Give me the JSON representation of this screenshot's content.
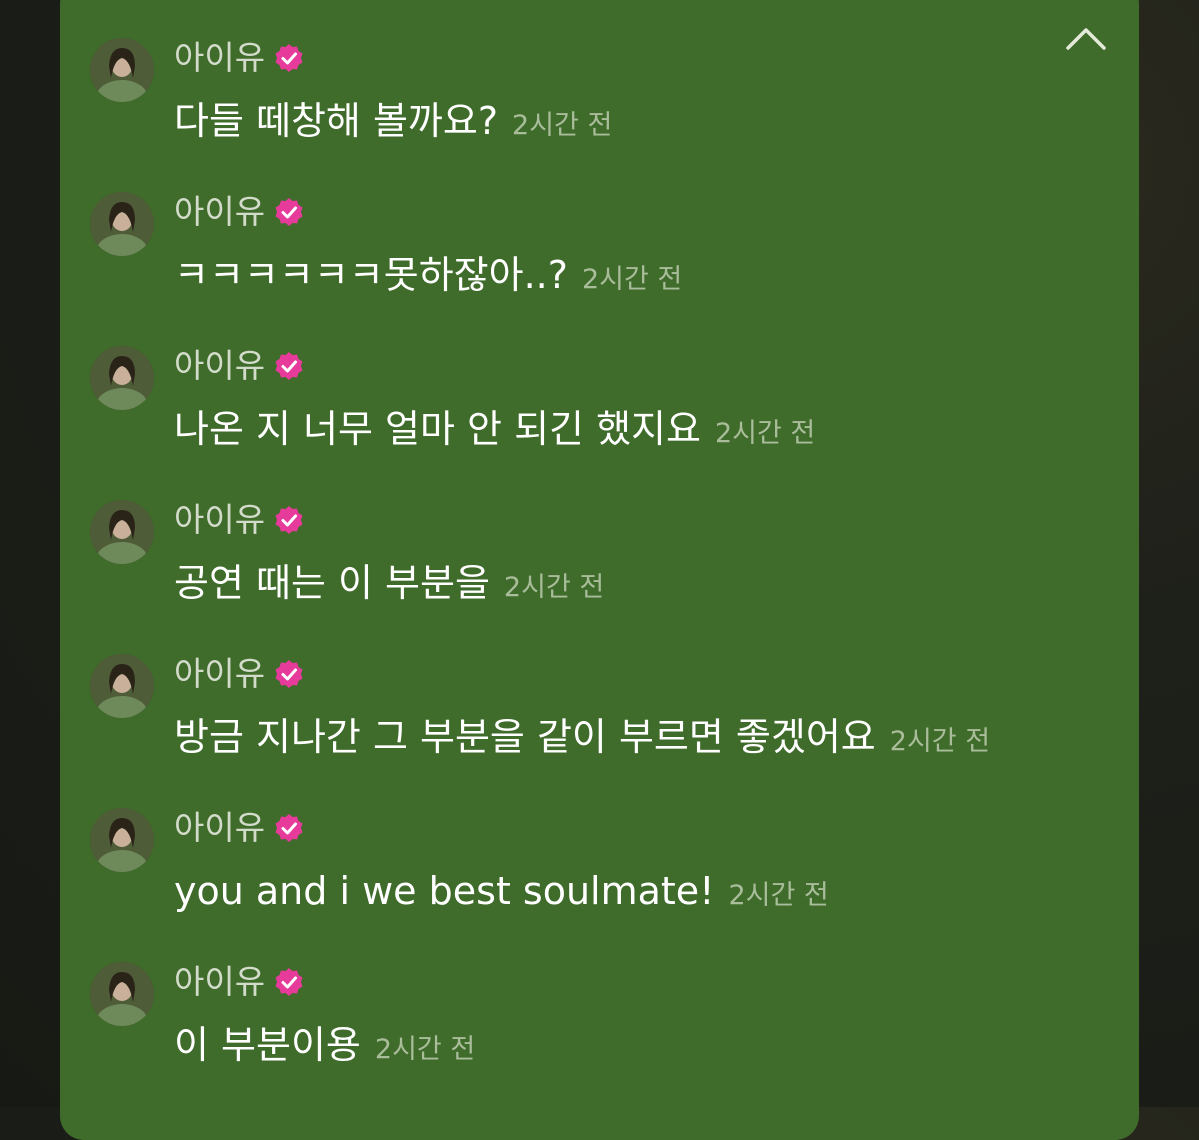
{
  "colors": {
    "panel_background": "#3f6b2b",
    "verified_badge": "#e63b9a",
    "timestamp": "#a9bd9a"
  },
  "header": {
    "collapse_icon": "chevron-up-icon"
  },
  "messages": [
    {
      "author": "아이유",
      "verified": true,
      "text": "다들 떼창해 볼까요?",
      "time": "2시간 전"
    },
    {
      "author": "아이유",
      "verified": true,
      "text": "ㅋㅋㅋㅋㅋㅋ못하잖아..?",
      "time": "2시간 전"
    },
    {
      "author": "아이유",
      "verified": true,
      "text": "나온 지 너무 얼마 안 되긴 했지요",
      "time": "2시간 전"
    },
    {
      "author": "아이유",
      "verified": true,
      "text": "공연 때는 이 부분을",
      "time": "2시간 전"
    },
    {
      "author": "아이유",
      "verified": true,
      "text": "방금 지나간 그 부분을 같이 부르면 좋겠어요",
      "time": "2시간 전"
    },
    {
      "author": "아이유",
      "verified": true,
      "text": "you and i we best soulmate!",
      "time": "2시간 전"
    },
    {
      "author": "아이유",
      "verified": true,
      "text": "이 부분이용",
      "time": "2시간 전"
    }
  ]
}
